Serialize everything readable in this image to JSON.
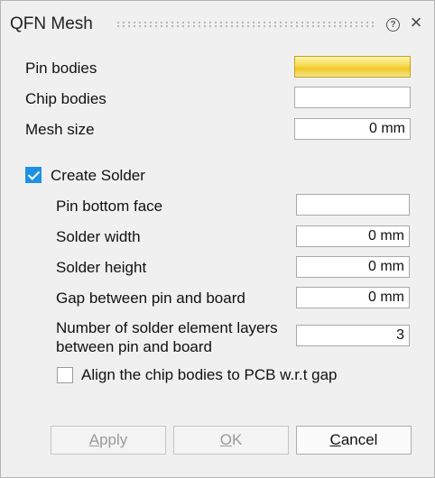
{
  "dialog": {
    "title": "QFN Mesh",
    "help_icon": "help-circle-icon",
    "close_icon": "close-icon"
  },
  "fields": {
    "pin_bodies": {
      "label": "Pin bodies",
      "value": "",
      "state": "selected"
    },
    "chip_bodies": {
      "label": "Chip bodies",
      "value": ""
    },
    "mesh_size": {
      "label": "Mesh size",
      "value": "0 mm"
    }
  },
  "create_solder": {
    "label": "Create Solder",
    "checked": true,
    "pin_bottom_face": {
      "label": "Pin bottom face",
      "value": ""
    },
    "solder_width": {
      "label": "Solder width",
      "value": "0 mm"
    },
    "solder_height": {
      "label": "Solder height",
      "value": "0 mm"
    },
    "gap": {
      "label": "Gap between pin and board",
      "value": "0 mm"
    },
    "layers": {
      "label_line1": "Number of solder element layers",
      "label_line2": "between pin and board",
      "value": "3"
    },
    "align": {
      "label": "Align the chip bodies to PCB w.r.t gap",
      "checked": false
    }
  },
  "buttons": {
    "apply": {
      "mnemonic": "A",
      "rest": "pply",
      "enabled": false
    },
    "ok": {
      "mnemonic": "O",
      "rest": "K",
      "enabled": false
    },
    "cancel": {
      "mnemonic": "C",
      "rest": "ancel",
      "enabled": true
    }
  },
  "colors": {
    "accent": "#1e90e6",
    "selection_fill": "#f6d94c",
    "background": "#f0f0f0"
  }
}
